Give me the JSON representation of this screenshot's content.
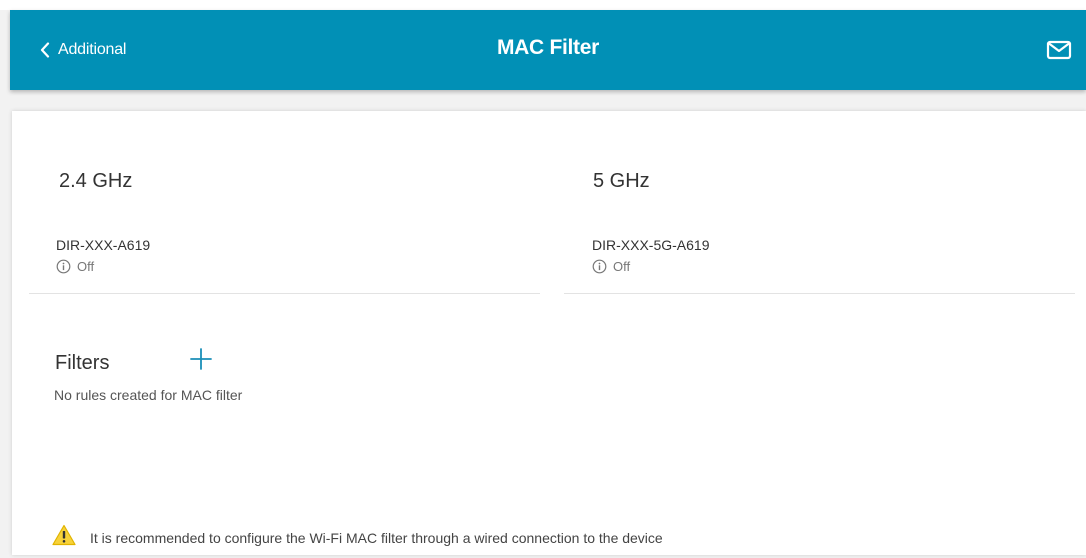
{
  "header": {
    "back_label": "Additional",
    "title": "MAC Filter",
    "icons": {
      "back": "chevron-left-icon",
      "mail": "mail-icon"
    },
    "background_color": "#0190b6"
  },
  "bands": [
    {
      "title": "2.4 GHz",
      "ssid": "DIR-XXX-A619",
      "status": "Off",
      "status_icon": "info-icon"
    },
    {
      "title": "5 GHz",
      "ssid": "DIR-XXX-5G-A619",
      "status": "Off",
      "status_icon": "info-icon"
    }
  ],
  "filters": {
    "title": "Filters",
    "add_icon": "plus-icon",
    "empty_text": "No rules created for MAC filter"
  },
  "warning": {
    "icon": "warning-icon",
    "text": "It is recommended to configure the Wi-Fi MAC filter through a wired connection to the device",
    "icon_color": "#f2c500"
  }
}
